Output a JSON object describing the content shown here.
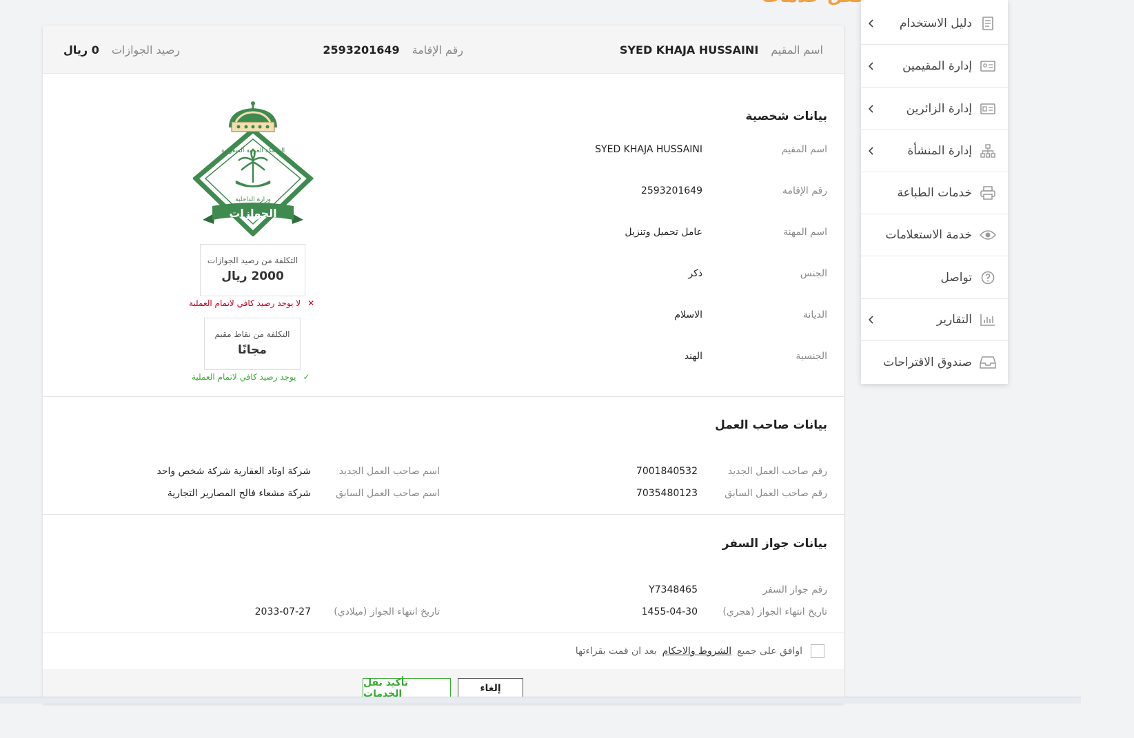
{
  "page": {
    "title": "نقل خدمات"
  },
  "sidebar": {
    "items": [
      {
        "label": "دليل الاستخدام",
        "icon": "document-icon",
        "has_chevron": true
      },
      {
        "label": "إدارة المقيمين",
        "icon": "id-card-icon",
        "has_chevron": true
      },
      {
        "label": "إدارة الزائرين",
        "icon": "visitor-card-icon",
        "has_chevron": true
      },
      {
        "label": "إدارة المنشأة",
        "icon": "org-chart-icon",
        "has_chevron": true
      },
      {
        "label": "خدمات الطباعة",
        "icon": "printer-icon",
        "has_chevron": false
      },
      {
        "label": "خدمة الاستعلامات",
        "icon": "eye-icon",
        "has_chevron": false
      },
      {
        "label": "تواصل",
        "icon": "help-circle-icon",
        "has_chevron": false
      },
      {
        "label": "التقارير",
        "icon": "bar-chart-icon",
        "has_chevron": true
      },
      {
        "label": "صندوق الاقتراحات",
        "icon": "inbox-icon",
        "has_chevron": false
      }
    ]
  },
  "header": {
    "resident_name_label": "اسم المقيم",
    "resident_name": "SYED KHAJA HUSSAINI",
    "iqama_label": "رقم الإقامة",
    "iqama": "2593201649",
    "balance_label": "رصيد الجوازات",
    "balance": "0 ريال"
  },
  "personal": {
    "title": "بيانات شخصية",
    "rows": [
      {
        "label": "اسم المقيم",
        "value": "SYED KHAJA HUSSAINI"
      },
      {
        "label": "رقم الإقامة",
        "value": "2593201649"
      },
      {
        "label": "اسم المهنة",
        "value": "عامل تحميل وتنزيل"
      },
      {
        "label": "الجنس",
        "value": "ذكر"
      },
      {
        "label": "الديانة",
        "value": "الاسلام"
      },
      {
        "label": "الجنسية",
        "value": "الهند"
      }
    ]
  },
  "logo": {
    "text_top": "المملكة العربية السعودية",
    "text_mid": "وزارة الداخلية",
    "text_banner": "الجوازات"
  },
  "costs": {
    "jawazat_label": "التكلفة من رصيد الجوازات",
    "jawazat_amount": "2000 ريال",
    "jawazat_msg": "لا يوجد رصيد كافي لاتمام العملية",
    "points_label": "التكلفة من نقاط مقيم",
    "points_amount": "مجانًا",
    "points_msg": "يوجد رصيد كافي لاتمام العملية",
    "error_color": "#d0021b",
    "ok_color": "#3aaa35"
  },
  "employer": {
    "title": "بيانات صاحب العمل",
    "new_number_label": "رقم صاحب العمل الجديد",
    "new_number": "7001840532",
    "new_name_label": "اسم صاحب العمل الجديد",
    "new_name": "شركة اوتاد العقارية شركة شخص واحد",
    "old_number_label": "رقم صاحب العمل السابق",
    "old_number": "7035480123",
    "old_name_label": "اسم صاحب العمل السابق",
    "old_name": "شركة مشعاء فالح المصارير التجارية"
  },
  "passport": {
    "title": "بيانات جواز السفر",
    "number_label": "رقم جواز السفر",
    "number": "Y7348465",
    "expiry_hijri_label": "تاريخ انتهاء الجواز (هجري)",
    "expiry_hijri": "1455-04-30",
    "expiry_greg_label": "تاريخ انتهاء الجواز (ميلادي)",
    "expiry_greg": "2033-07-27"
  },
  "terms": {
    "prefix": "اوافق على جميع",
    "link": "الشروط والاحكام",
    "suffix": "بعد ان قمت بقراءتها"
  },
  "actions": {
    "cancel": "إلغاء",
    "confirm": "تأكيد نقل الخدمات"
  }
}
